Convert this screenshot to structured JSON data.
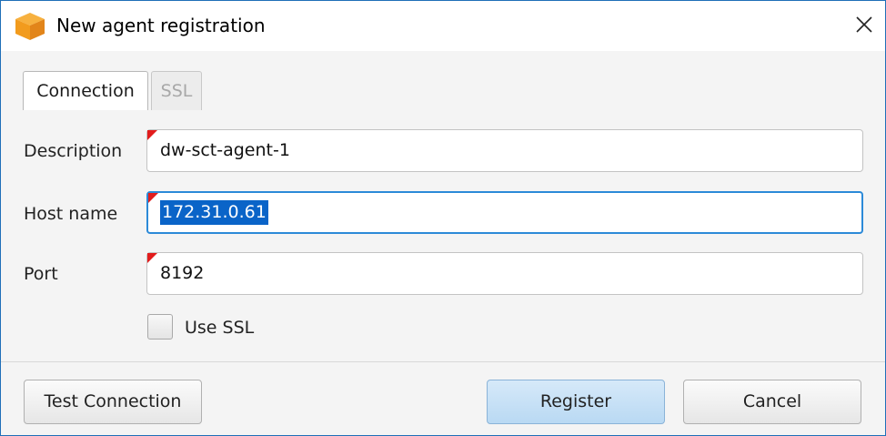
{
  "window": {
    "title": "New agent registration",
    "app_icon": "orange-cube-icon",
    "close_icon": "close-icon"
  },
  "tabs": [
    {
      "label": "Connection",
      "active": true
    },
    {
      "label": "SSL",
      "active": false
    }
  ],
  "fields": {
    "description": {
      "label": "Description",
      "value": "dw-sct-agent-1"
    },
    "host_name": {
      "label": "Host name",
      "value": "172.31.0.61"
    },
    "port": {
      "label": "Port",
      "value": "8192"
    }
  },
  "use_ssl": {
    "label": "Use SSL",
    "checked": false
  },
  "buttons": {
    "test_connection": "Test Connection",
    "register": "Register",
    "cancel": "Cancel"
  },
  "colors": {
    "accent": "#2c8ad8",
    "selection": "#0a64c8",
    "required_marker": "#e21c1c",
    "app_icon": "#f29b1d",
    "primary_button": "#b9d9f3"
  }
}
